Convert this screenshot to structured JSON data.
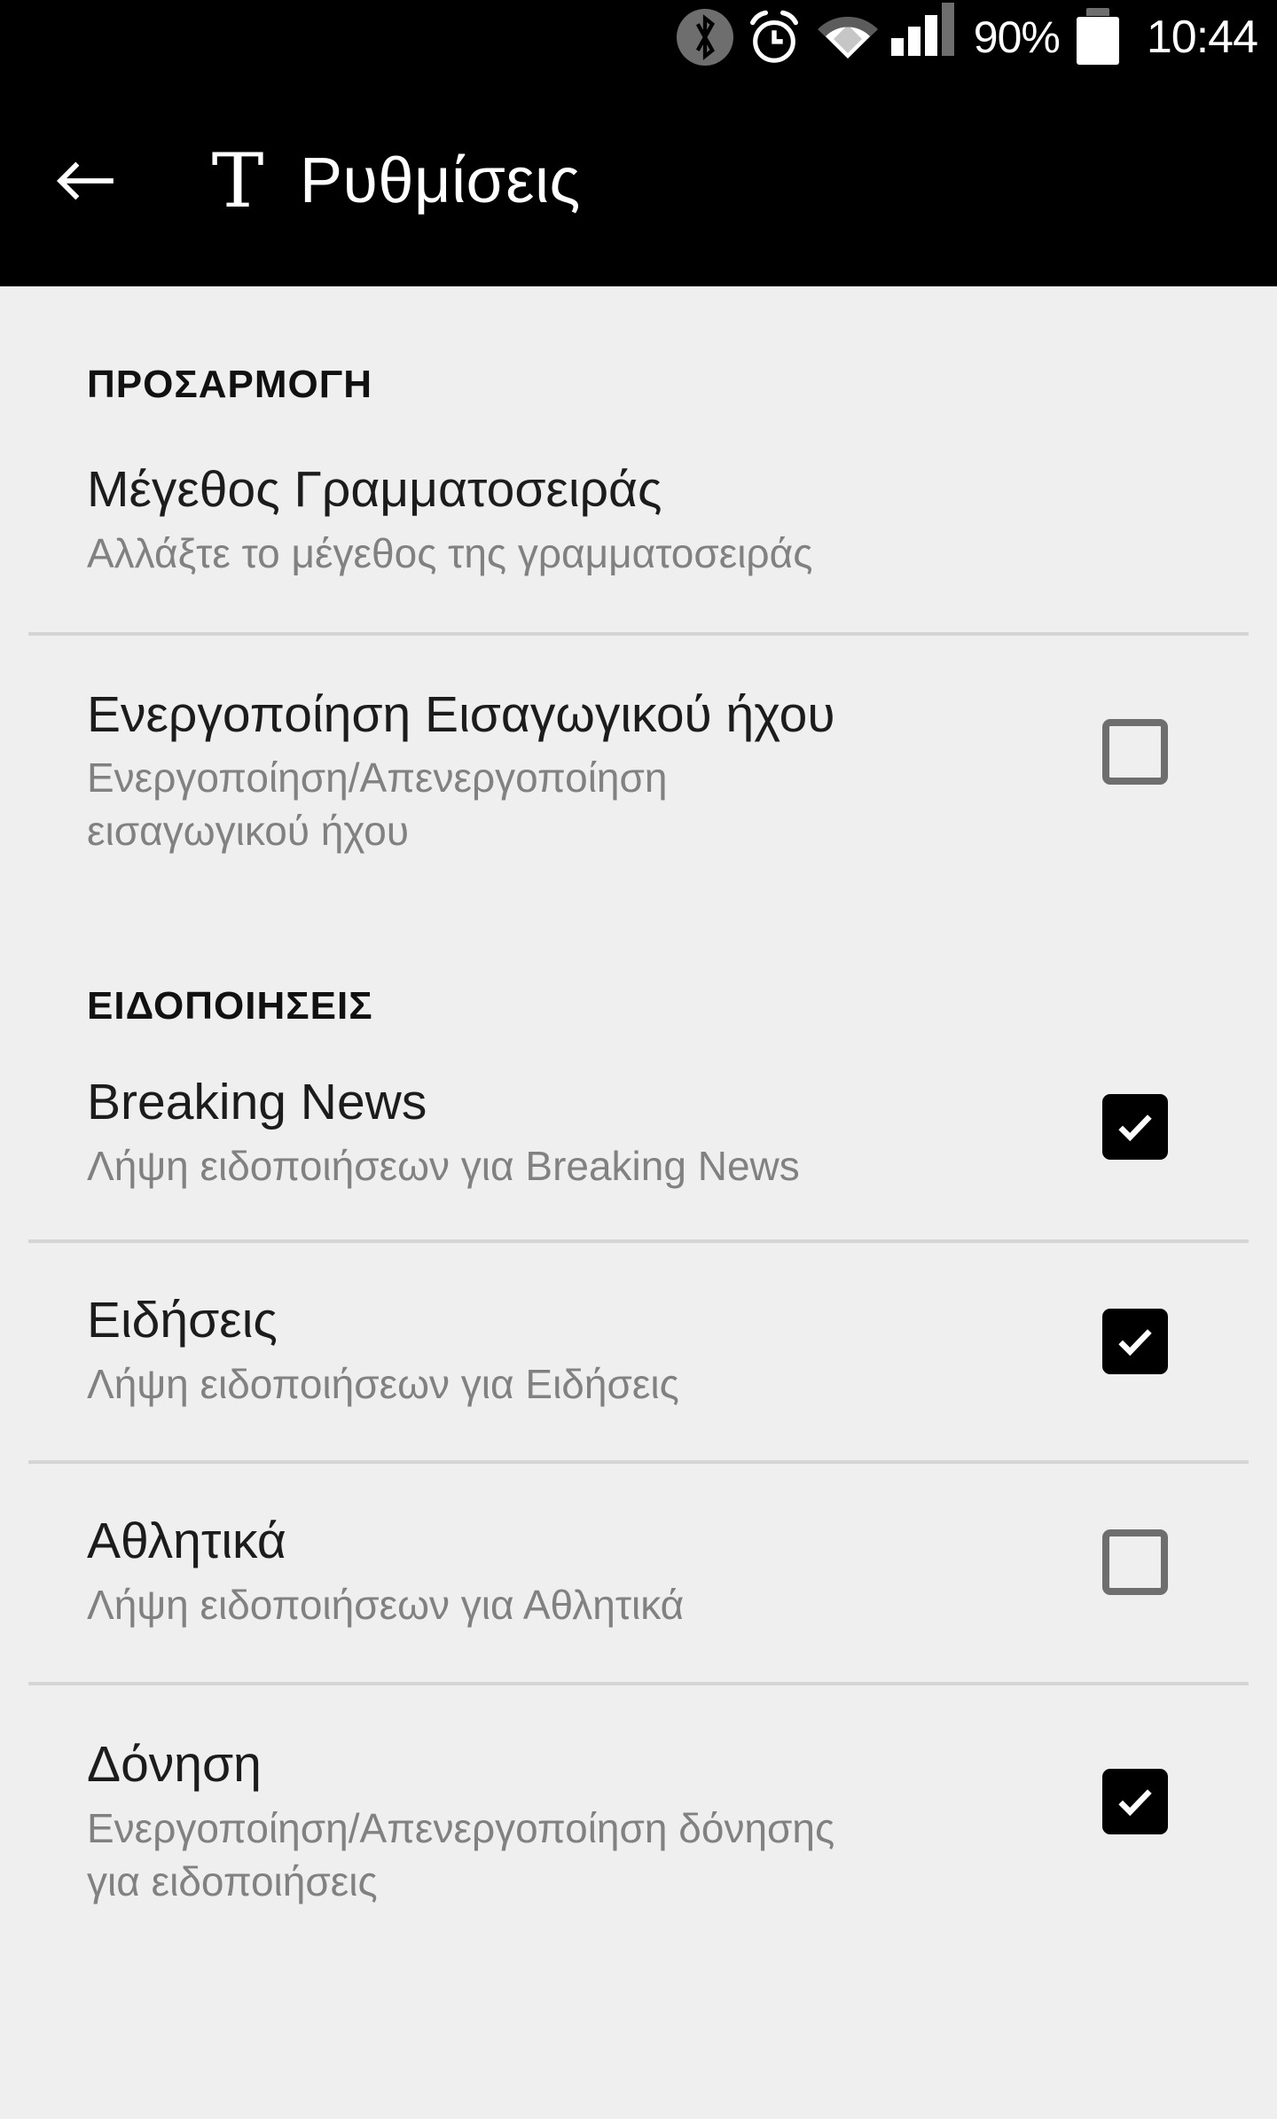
{
  "status_bar": {
    "bluetooth_icon": "bluetooth-icon",
    "alarm_icon": "alarm-clock-icon",
    "wifi_icon": "wifi-icon",
    "signal_icon": "cellular-signal-icon",
    "battery_percent": "90%",
    "battery_icon": "battery-icon",
    "time": "10:44"
  },
  "app_bar": {
    "back_icon": "back-arrow-icon",
    "logo": "T",
    "title": "Ρυθμίσεις"
  },
  "sections": [
    {
      "header": "ΠΡΟΣΑΡΜΟΓΗ",
      "items": [
        {
          "title": "Μέγεθος Γραμματοσειράς",
          "subtitle": "Αλλάξτε το μέγεθος της γραμματοσειράς",
          "has_checkbox": false,
          "checked": false
        },
        {
          "title": "Ενεργοποίηση Εισαγωγικού ήχου",
          "subtitle_line1": "Ενεργοποίηση/Απενεργοποίηση",
          "subtitle_line2": "εισαγωγικού ήχου",
          "has_checkbox": true,
          "checked": false
        }
      ]
    },
    {
      "header": "ΕΙΔΟΠΟΙΗΣΕΙΣ",
      "items": [
        {
          "title": "Breaking News",
          "subtitle": "Λήψη ειδοποιήσεων για Breaking News",
          "has_checkbox": true,
          "checked": true
        },
        {
          "title": "Ειδήσεις",
          "subtitle": "Λήψη ειδοποιήσεων για Ειδήσεις",
          "has_checkbox": true,
          "checked": true
        },
        {
          "title": "Αθλητικά",
          "subtitle": "Λήψη ειδοποιήσεων για Αθλητικά",
          "has_checkbox": true,
          "checked": false
        },
        {
          "title": "Δόνηση",
          "subtitle_line1": "Ενεργοποίηση/Απενεργοποίηση δόνησης",
          "subtitle_line2": "για ειδοποιήσεις",
          "has_checkbox": true,
          "checked": true
        }
      ]
    }
  ],
  "colors": {
    "app_bar_bg": "#000000",
    "content_bg": "#efefef",
    "title_text": "#1c1c1c",
    "subtitle_text": "#818181",
    "divider": "#d5d5d5",
    "checkbox_off": "#6e6e6e",
    "checkbox_on": "#000000"
  }
}
